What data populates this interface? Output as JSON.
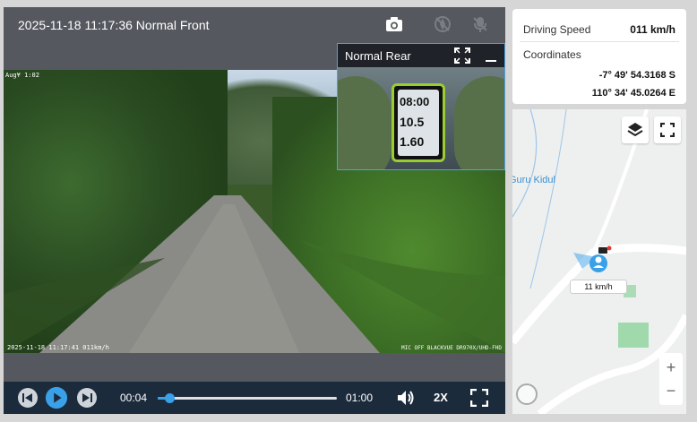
{
  "video": {
    "front_title": "2025-11-18 11:17:36 Normal Front",
    "rear_title": "Normal Rear",
    "osd_top": "Aug¥ 1:02",
    "osd_timestamp": "2025-11-18 11:17:41 011km/h",
    "osd_model": "MIC OFF BLACKVUE DR970X/UHD-FHD",
    "rear_gauge": {
      "time": "08:00",
      "distance": "10.5",
      "speed": "1.60"
    }
  },
  "controls": {
    "current_time": "00:04",
    "total_time": "01:00",
    "playback_speed": "2X",
    "progress": 0.067
  },
  "info": {
    "speed_label": "Driving Speed",
    "speed_value": "011 km/h",
    "coord_label": "Coordinates",
    "latitude": "-7° 49' 54.3168 S",
    "longitude": "110° 34' 45.0264 E"
  },
  "map": {
    "place_label": "Guru Kidul",
    "marker_speed": "11 km/h",
    "zoom_in": "+",
    "zoom_out": "−"
  },
  "icons": {
    "camera": "camera-icon",
    "snapshot_disabled": "compass-off-icon",
    "mute_disabled": "mic-off-icon",
    "expand": "expand-icon",
    "minimize": "minimize-icon",
    "prev": "prev-icon",
    "play": "play-icon",
    "next": "next-icon",
    "volume": "volume-icon",
    "fullscreen": "fullscreen-icon",
    "layers": "layers-icon",
    "map_fullscreen": "map-fullscreen-icon"
  },
  "colors": {
    "accent": "#3aa0e8",
    "control_bar": "#1c2b3c",
    "panel": "#55585e"
  }
}
